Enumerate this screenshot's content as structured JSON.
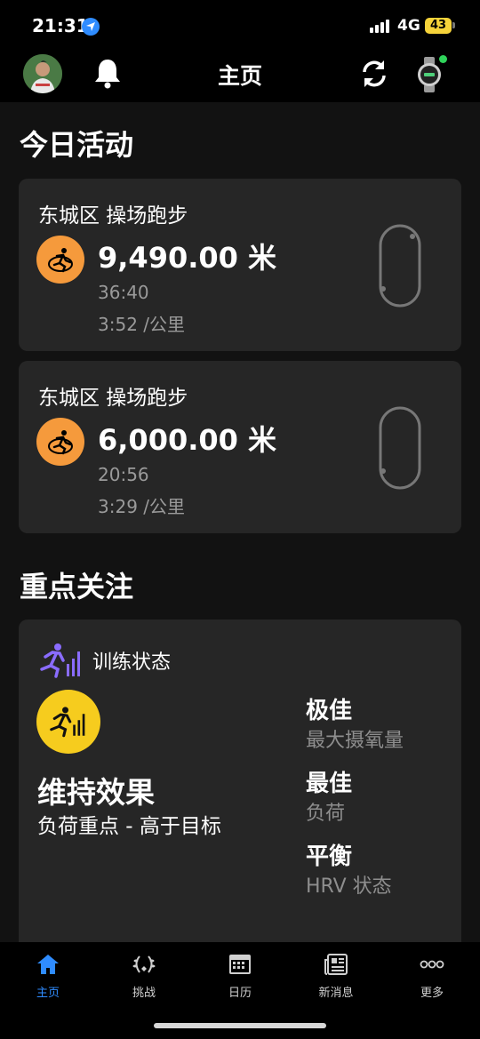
{
  "status_bar": {
    "time": "21:31",
    "network": "4G",
    "battery": "43"
  },
  "header": {
    "title": "主页"
  },
  "today": {
    "section_title": "今日活动",
    "activities": [
      {
        "title": "东城区 操场跑步",
        "distance": "9,490.00 米",
        "duration": "36:40",
        "pace": "3:52 /公里"
      },
      {
        "title": "东城区 操场跑步",
        "distance": "6,000.00 米",
        "duration": "20:56",
        "pace": "3:29 /公里"
      }
    ]
  },
  "focus": {
    "section_title": "重点关注",
    "training_status": {
      "label": "训练状态",
      "status": "维持效果",
      "description": "负荷重点 - 高于目标",
      "metrics": [
        {
          "value": "极佳",
          "label": "最大摄氧量"
        },
        {
          "value": "最佳",
          "label": "负荷"
        },
        {
          "value": "平衡",
          "label": "HRV 状态"
        }
      ]
    }
  },
  "tabs": [
    {
      "label": "主页",
      "icon": "home-icon",
      "active": true
    },
    {
      "label": "挑战",
      "icon": "laurel-icon",
      "active": false
    },
    {
      "label": "日历",
      "icon": "calendar-icon",
      "active": false
    },
    {
      "label": "新消息",
      "icon": "newspaper-icon",
      "active": false
    },
    {
      "label": "更多",
      "icon": "more-icon",
      "active": false
    }
  ],
  "colors": {
    "accent_blue": "#2f8cff",
    "run_orange": "#f59a3c",
    "status_yellow": "#f6cc1e",
    "card_bg": "#262626",
    "training_purple": "#8a6cff"
  }
}
